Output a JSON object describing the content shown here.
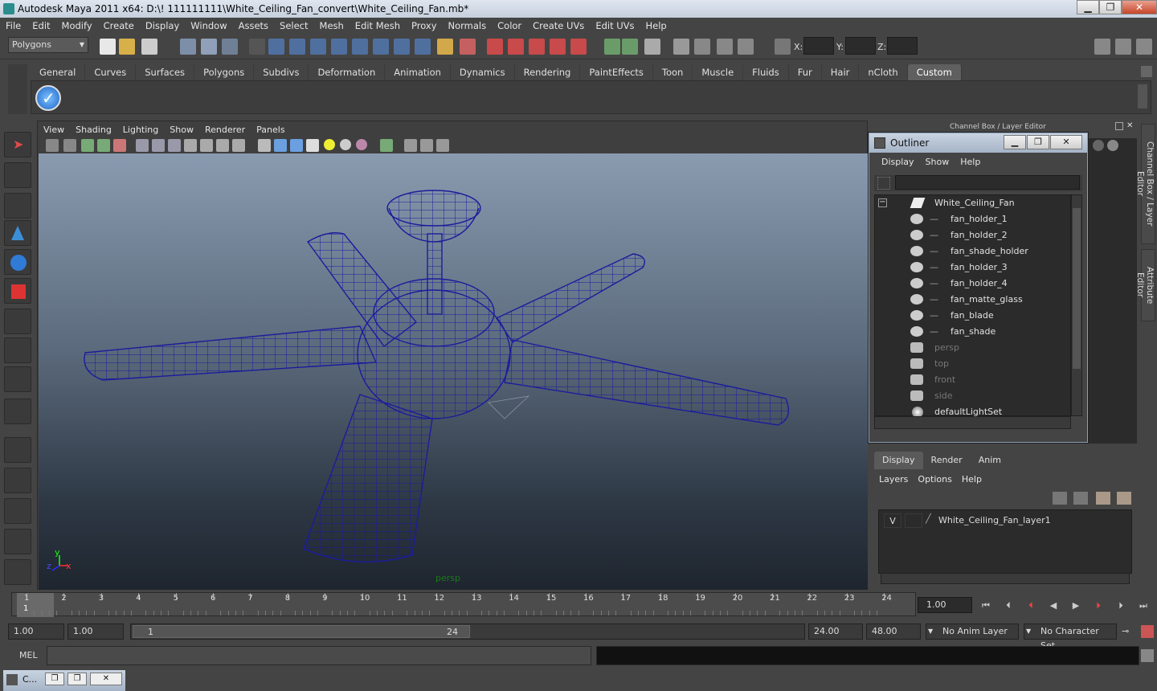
{
  "window": {
    "title": "Autodesk Maya 2011 x64: D:\\! 111111111\\White_Ceiling_Fan_convert\\White_Ceiling_Fan.mb*",
    "min": "▁",
    "max": "❐",
    "close": "✕"
  },
  "menu": [
    "File",
    "Edit",
    "Modify",
    "Create",
    "Display",
    "Window",
    "Assets",
    "Select",
    "Mesh",
    "Edit Mesh",
    "Proxy",
    "Normals",
    "Color",
    "Create UVs",
    "Edit UVs",
    "Help"
  ],
  "status": {
    "mode": "Polygons",
    "x_label": "X:",
    "y_label": "Y:",
    "z_label": "Z:"
  },
  "shelf": {
    "tabs": [
      "General",
      "Curves",
      "Surfaces",
      "Polygons",
      "Subdivs",
      "Deformation",
      "Animation",
      "Dynamics",
      "Rendering",
      "PaintEffects",
      "Toon",
      "Muscle",
      "Fluids",
      "Fur",
      "Hair",
      "nCloth",
      "Custom"
    ],
    "active": "Custom"
  },
  "viewport": {
    "menu": [
      "View",
      "Shading",
      "Lighting",
      "Show",
      "Renderer",
      "Panels"
    ],
    "camera": "persp",
    "axis_y": "y",
    "axis_z": "z",
    "axis_x": "x"
  },
  "panel_title": "Channel Box / Layer Editor",
  "outliner": {
    "title": "Outliner",
    "menu": [
      "Display",
      "Show",
      "Help"
    ],
    "root": "White_Ceiling_Fan",
    "children": [
      "fan_holder_1",
      "fan_holder_2",
      "fan_shade_holder",
      "fan_holder_3",
      "fan_holder_4",
      "fan_matte_glass",
      "fan_blade",
      "fan_shade"
    ],
    "cameras": [
      "persp",
      "top",
      "front",
      "side"
    ],
    "sets": [
      "defaultLightSet"
    ],
    "collapse": "−"
  },
  "layers": {
    "tabs": [
      "Display",
      "Render",
      "Anim"
    ],
    "active": "Display",
    "menu": [
      "Layers",
      "Options",
      "Help"
    ],
    "items": [
      {
        "visible": "V",
        "name": "White_Ceiling_Fan_layer1"
      }
    ]
  },
  "side_tabs": [
    "Channel Box / Layer Editor",
    "Attribute Editor"
  ],
  "timeline": {
    "ticks": [
      "1",
      "2",
      "3",
      "4",
      "5",
      "6",
      "7",
      "8",
      "9",
      "10",
      "11",
      "12",
      "13",
      "14",
      "15",
      "16",
      "17",
      "18",
      "19",
      "20",
      "21",
      "22",
      "23",
      "24"
    ],
    "current_frame": "1.00",
    "current_marker": "1"
  },
  "range": {
    "start": "1.00",
    "start2": "1.00",
    "slider_start": "1",
    "slider_end": "24",
    "end": "24.00",
    "end2": "48.00",
    "anim_layer": "No Anim Layer",
    "char_set": "No Character Set"
  },
  "cmd": {
    "label": "MEL"
  },
  "taskbar": {
    "item": "C..."
  }
}
